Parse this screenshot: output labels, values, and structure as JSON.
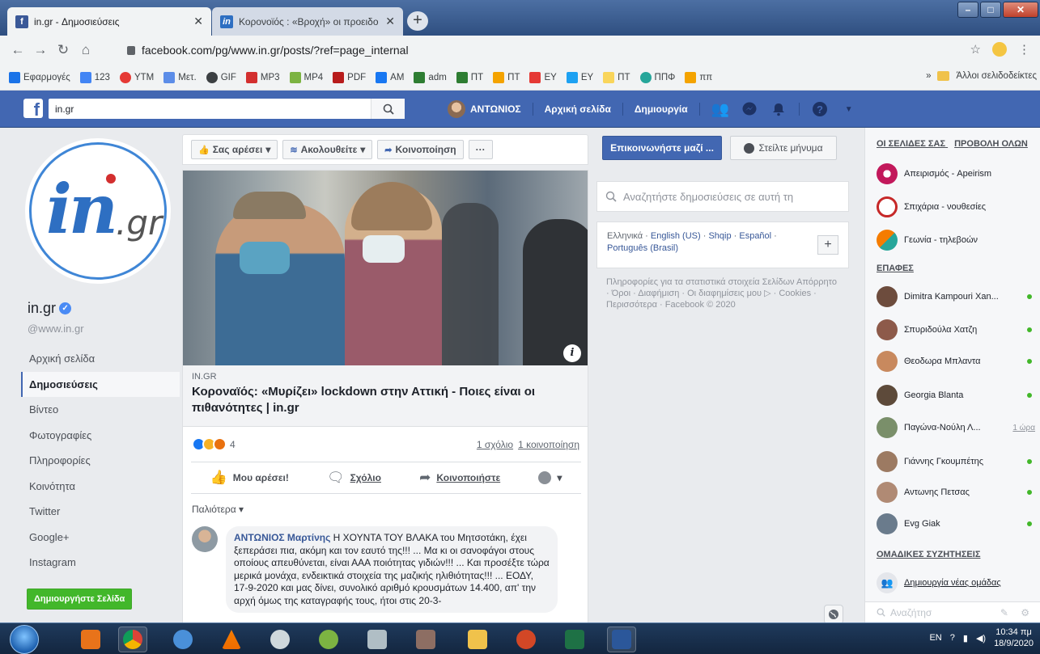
{
  "browser": {
    "tabs": [
      {
        "label": "in.gr - Δημοσιεύσεις",
        "icon": "facebook-icon",
        "active": true
      },
      {
        "label": "Κορονοϊός : «Βροχή» οι προειδο",
        "icon": "in-gr-icon",
        "active": false
      }
    ],
    "new_tab": "+",
    "url": "facebook.com/pg/www.in.gr/posts/?ref=page_internal",
    "bookmarks": [
      {
        "label": "Εφαρμογές",
        "color": "#1a73e8"
      },
      {
        "label": "123",
        "color": "#4285f4"
      },
      {
        "label": "YTM",
        "color": "#e53935"
      },
      {
        "label": "Μετ.",
        "color": "#5c8de8"
      },
      {
        "label": "GIF",
        "color": "#3c4043"
      },
      {
        "label": "MP3",
        "color": "#d32f2f"
      },
      {
        "label": "MP4",
        "color": "#7cb342"
      },
      {
        "label": "PDF",
        "color": "#b71c1c"
      },
      {
        "label": "AM",
        "color": "#1877f2"
      },
      {
        "label": "adm",
        "color": "#2e7d32"
      },
      {
        "label": "ΠΤ",
        "color": "#2e7d32"
      },
      {
        "label": "ΠΤ",
        "color": "#f4a300"
      },
      {
        "label": "EY",
        "color": "#e53935"
      },
      {
        "label": "EY",
        "color": "#1da1f2"
      },
      {
        "label": "ΠΤ",
        "color": "#f9d55b"
      },
      {
        "label": "ΠΠΦ",
        "color": "#26a69a"
      },
      {
        "label": "ππ",
        "color": "#f4a300"
      }
    ],
    "bookmarks_more": "»",
    "other_bookmarks": "Άλλοι σελιδοδείκτες"
  },
  "fb": {
    "search_value": "in.gr",
    "user_name": "ΑΝΤΩΝΙΟΣ",
    "nav_home": "Αρχική σελίδα",
    "nav_create": "Δημιουργία"
  },
  "page": {
    "logo_in": "in",
    "logo_gr": ".gr",
    "name": "in.gr",
    "handle": "@www.in.gr",
    "nav": [
      "Αρχική σελίδα",
      "Δημοσιεύσεις",
      "Βίντεο",
      "Φωτογραφίες",
      "Πληροφορίες",
      "Κοινότητα",
      "Twitter",
      "Google+",
      "Instagram"
    ],
    "create_page": "Δημιουργήστε Σελίδα"
  },
  "actions": {
    "like": "Σας αρέσει",
    "follow": "Ακολουθείτε",
    "share": "Κοινοποίηση",
    "more": "···",
    "contact": "Επικοινωνήστε μαζί ...",
    "message": "Στείλτε μήνυμα"
  },
  "post": {
    "image_info": "i",
    "domain": "IN.GR",
    "title": "Κοροναϊός: «Μυρίζει» lockdown στην Αττική - Ποιες είναι οι πιθανότητες | in.gr",
    "reaction_count": "4",
    "comments": "1 σχόλιο",
    "shares": "1 κοινοποίηση",
    "like_btn": "Μου αρέσει!",
    "comment_btn": "Σχόλιο",
    "share_btn": "Κοινοποιήστε",
    "older": "Παλιότερα ▾",
    "comment_author": "ΑΝΤΩΝΙΟΣ Μαρτίνης",
    "comment_text": " Η ΧΟΥΝΤΑ ΤΟΥ ΒΛΑΚΑ του Μητσοτάκη, έχει ξεπεράσει πια, ακόμη και τον εαυτό της!!! ... Μα κι οι σανοφάγοι στους οποίους απευθύνεται, είναι ΑΑΑ ποιότητας γιδιών!!! ... Και προσέξτε τώρα μερικά μονάχα, ενδεικτικά στοιχεία της μαζικής ηλιθιότητας!!! ... ΕΟΔΥ, 17-9-2020 και μας δίνει, συνολικό αριθμό κρουσμάτων 14.400, απ' την αρχή όμως της καταγραφής τους, ήτοι στις 20-3-"
  },
  "sidebar": {
    "search_placeholder": "Αναζητήστε δημοσιεύσεις σε αυτή τη",
    "languages": [
      "Ελληνικά",
      "English (US)",
      "Shqip",
      "Español",
      "Português (Brasil)"
    ],
    "lang_plus": "+",
    "footer": "Πληροφορίες για τα στατιστικά στοιχεία Σελίδων Απόρρητο · Όροι · Διαφήμιση · Οι διαφημίσεις μου ▷ · Cookies · Περισσότερα · Facebook © 2020"
  },
  "chat": {
    "pages_heading": "ΟΙ ΣΕΛΙΔΕΣ ΣΑΣ",
    "see_all": "ΠΡΟΒΟΛΗ ΟΛΩΝ",
    "pages": [
      "Απειρισμός - Apeirism",
      "Σπιχάρια - νουθεσίες",
      "Γεωνία - τηλεβοών"
    ],
    "contacts_heading": "ΕΠΑΦΕΣ",
    "contacts": [
      {
        "name": "Dimitra Kampouri Xan...",
        "status": "online",
        "ago": ""
      },
      {
        "name": "Σπυριδούλα Χατζη",
        "status": "online",
        "ago": ""
      },
      {
        "name": "Θεοδωρα Μπλαντα",
        "status": "online",
        "ago": ""
      },
      {
        "name": "Georgia Blanta",
        "status": "online",
        "ago": ""
      },
      {
        "name": "Παγώνα-Νούλη Λ...",
        "status": "away",
        "ago": "1 ώρα"
      },
      {
        "name": "Γιάννης Γκουμπέτης",
        "status": "online",
        "ago": ""
      },
      {
        "name": "Αντωνης Πετσας",
        "status": "online",
        "ago": ""
      },
      {
        "name": "Evg Giak",
        "status": "online",
        "ago": ""
      }
    ],
    "groups_heading": "ΟΜΑΔΙΚΕΣ ΣΥΖΗΤΗΣΕΙΣ",
    "new_group": "Δημιουργία νέας ομάδας",
    "search_placeholder": "Αναζήτησ"
  },
  "taskbar": {
    "lang": "EN",
    "time": "10:34 πμ",
    "date": "18/9/2020"
  }
}
